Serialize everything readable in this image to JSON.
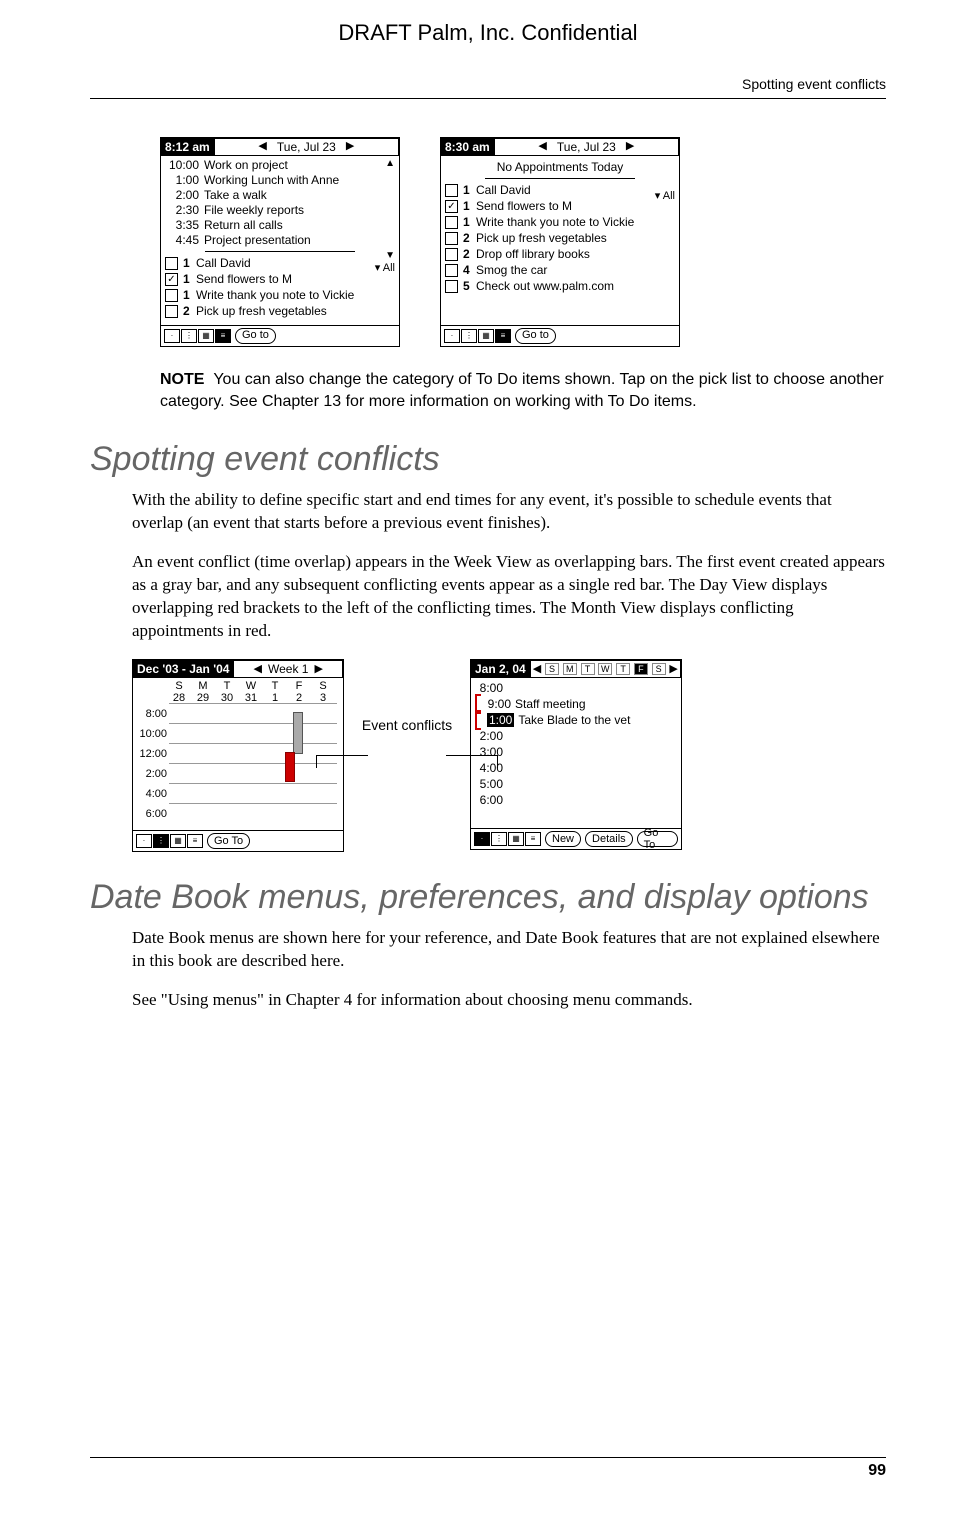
{
  "draft_header": "DRAFT   Palm, Inc. Confidential",
  "running_head": "Spotting event conflicts",
  "page_number": "99",
  "screenshot_a": {
    "time": "8:12 am",
    "date": "Tue, Jul 23",
    "appointments": [
      {
        "t": "10:00",
        "txt": "Work on project"
      },
      {
        "t": "1:00",
        "txt": "Working Lunch with Anne"
      },
      {
        "t": "2:00",
        "txt": "Take a walk"
      },
      {
        "t": "2:30",
        "txt": "File weekly reports"
      },
      {
        "t": "3:35",
        "txt": "Return all calls"
      },
      {
        "t": "4:45",
        "txt": "Project presentation"
      }
    ],
    "all_label": "All",
    "todos": [
      {
        "done": false,
        "pri": "1",
        "txt": "Call David"
      },
      {
        "done": true,
        "pri": "1",
        "txt": "Send flowers to M"
      },
      {
        "done": false,
        "pri": "1",
        "txt": "Write thank you note to Vickie"
      },
      {
        "done": false,
        "pri": "2",
        "txt": "Pick up fresh vegetables"
      }
    ],
    "goto": "Go to"
  },
  "screenshot_b": {
    "time": "8:30 am",
    "date": "Tue, Jul 23",
    "no_appt": "No Appointments Today",
    "all_label": "All",
    "todos": [
      {
        "done": false,
        "pri": "1",
        "txt": "Call David"
      },
      {
        "done": true,
        "pri": "1",
        "txt": "Send flowers to M"
      },
      {
        "done": false,
        "pri": "1",
        "txt": "Write thank you note to Vickie"
      },
      {
        "done": false,
        "pri": "2",
        "txt": "Pick up fresh vegetables"
      },
      {
        "done": false,
        "pri": "2",
        "txt": "Drop off library books"
      },
      {
        "done": false,
        "pri": "4",
        "txt": "Smog the car"
      },
      {
        "done": false,
        "pri": "5",
        "txt": "Check out www.palm.com"
      }
    ],
    "goto": "Go to"
  },
  "note": {
    "label": "NOTE",
    "text_1": "You can also change the category of To Do items shown. Tap on the pick list to choose another category. See ",
    "link": "Chapter 13",
    "text_2": " for more information on working with To Do items."
  },
  "heading_1": "Spotting event conflicts",
  "para_1": "With the ability to define specific start and end times for any event, it's possible to schedule events that overlap (an event that starts before a previous event finishes).",
  "para_2": "An event conflict (time overlap) appears in the Week View as overlapping bars. The first event created appears as a gray bar, and any subsequent conflicting events appear as a single red bar. The Day View displays overlapping red brackets to the left of the conflicting times. The Month View displays conflicting appointments in red.",
  "week_view": {
    "title": "Dec '03 - Jan '04",
    "nav": "Week   1",
    "days": [
      "S",
      "M",
      "T",
      "W",
      "T",
      "F",
      "S"
    ],
    "dates": [
      "28",
      "29",
      "30",
      "31",
      "1",
      "2",
      "3"
    ],
    "times": [
      "8:00",
      "10:00",
      "12:00",
      "2:00",
      "4:00",
      "6:00"
    ],
    "goto": "Go To"
  },
  "callout_label": "Event conflicts",
  "day_view": {
    "title": "Jan 2, 04",
    "dow": [
      "S",
      "M",
      "T",
      "W",
      "T",
      "F",
      "S"
    ],
    "lines": [
      {
        "t": "8:00",
        "txt": ""
      },
      {
        "t": "9:00",
        "txt": "Staff meeting"
      },
      {
        "t": "1:00",
        "txt": "Take Blade to the vet",
        "hl": true
      },
      {
        "t": "2:00",
        "txt": ""
      },
      {
        "t": "3:00",
        "txt": ""
      },
      {
        "t": "4:00",
        "txt": ""
      },
      {
        "t": "5:00",
        "txt": ""
      },
      {
        "t": "6:00",
        "txt": ""
      }
    ],
    "new_btn": "New",
    "details_btn": "Details",
    "goto": "Go To"
  },
  "heading_2": "Date Book menus, preferences, and display options",
  "para_3": "Date Book menus are shown here for your reference, and Date Book features that are not explained elsewhere in this book are described here.",
  "para_4a": "See ",
  "para_4_link1": "\"Using menus\"",
  "para_4b": " in ",
  "para_4_link2": "Chapter 4",
  "para_4c": " for information about choosing menu commands."
}
